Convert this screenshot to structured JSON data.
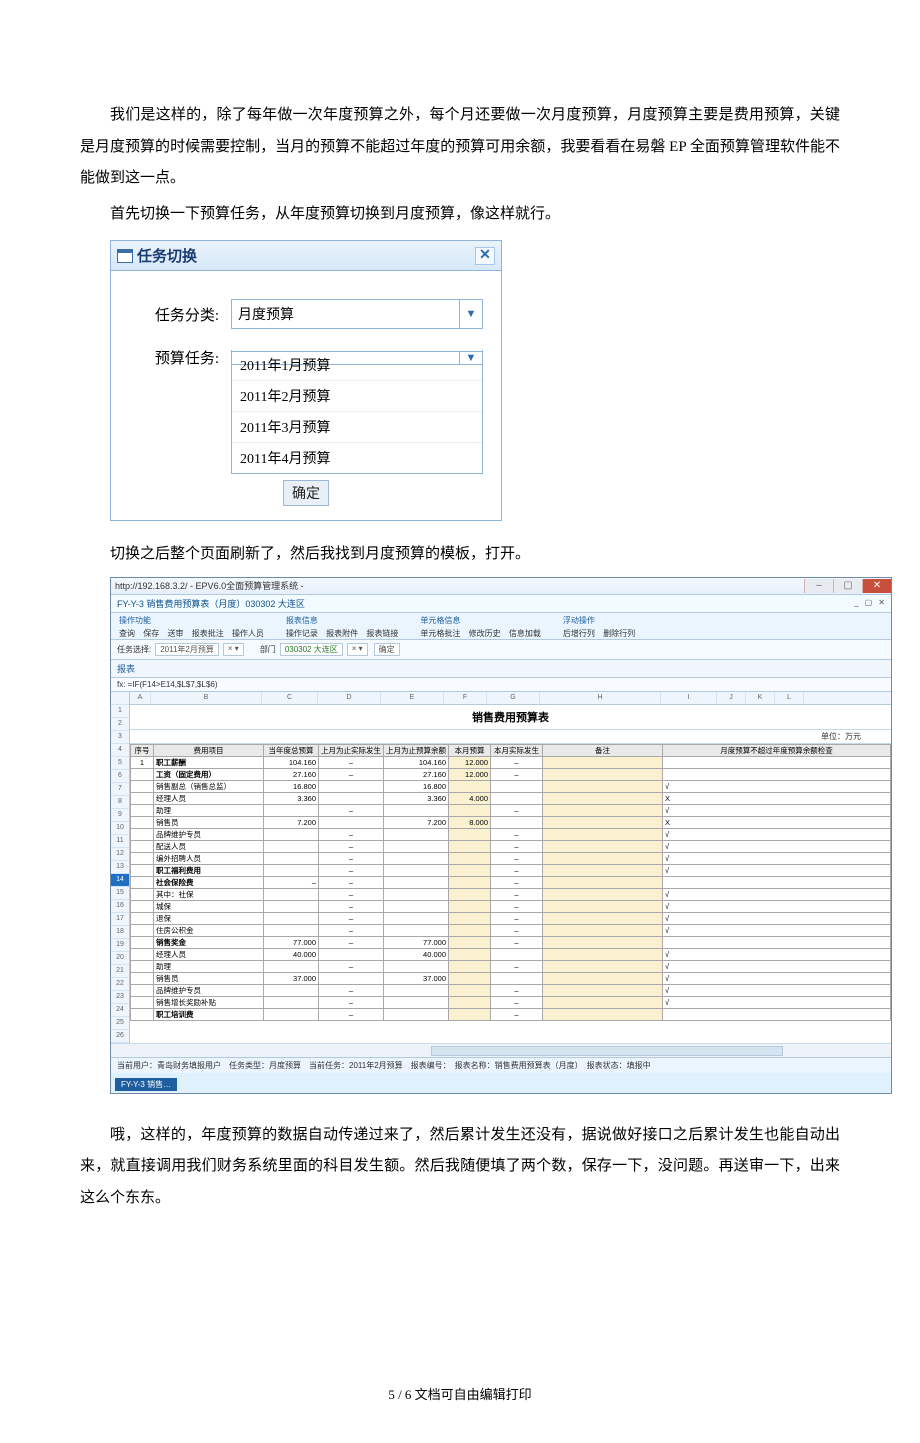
{
  "para1": "我们是这样的，除了每年做一次年度预算之外，每个月还要做一次月度预算，月度预算主要是费用预算，关键是月度预算的时候需要控制，当月的预算不能超过年度的预算可用余额，我要看看在易磐 EP 全面预算管理软件能不能做到这一点。",
  "para2": "首先切换一下预算任务，从年度预算切换到月度预算，像这样就行。",
  "para3": "切换之后整个页面刷新了，然后我找到月度预算的模板，打开。",
  "para4": "哦，这样的，年度预算的数据自动传递过来了，然后累计发生还没有，据说做好接口之后累计发生也能自动出来，就直接调用我们财务系统里面的科目发生额。然后我随便填了两个数，保存一下，没问题。再送审一下，出来这么个东东。",
  "footer": "5 / 6 文档可自由编辑打印",
  "dialog1": {
    "title": "任务切换",
    "lbl_category": "任务分类:",
    "lbl_task": "预算任务:",
    "category_value": "月度预算",
    "task_value": "",
    "options": [
      "2011年1月预算",
      "2011年2月预算",
      "2011年3月预算",
      "2011年4月预算"
    ],
    "ok": "确定"
  },
  "app": {
    "addr": "http://192.168.3.2/ - EPV6.0全面预算管理系统 -",
    "subtitle": "FY-Y-3 销售费用预算表（月度）030302 大连区",
    "groups": {
      "g1": "操作功能",
      "g1r": [
        "查询",
        "保存",
        "送审",
        "报表批注",
        "操作人员"
      ],
      "g2": "报表信息",
      "g2r": [
        "操作记录",
        "报表附件",
        "报表链接"
      ],
      "g3": "单元格信息",
      "g3r": [
        "单元格批注",
        "修改历史",
        "信息加载"
      ],
      "g4": "浮动操作",
      "g4r": [
        "后增行列",
        "删除行列"
      ]
    },
    "taskline": {
      "lbl1": "任务选择:",
      "val1": "2011年2月预算",
      "lbl2": "部门",
      "val2": "030302 大连区",
      "btn": "确定"
    },
    "section": "报表",
    "fx": "fx: =IF(F14>E14,$L$7,$L$6)",
    "cols": [
      "A",
      "B",
      "C",
      "D",
      "E",
      "F",
      "G",
      "H",
      "I",
      "J",
      "K",
      "L"
    ],
    "title": "销售费用预算表",
    "unit": "单位：万元",
    "head": [
      "序号",
      "费用项目",
      "当年度总预算",
      "上月为止实际发生",
      "上月为止预算余额",
      "本月预算",
      "本月实际发生",
      "备注",
      "月度预算不超过年度预算余额检查"
    ],
    "rows": [
      {
        "n": "1",
        "name": "职工薪酬",
        "a": "104.160",
        "c": "104.160",
        "d": "12.000",
        "dash": true,
        "bold": true
      },
      {
        "n": "",
        "name": "工资（固定费用）",
        "a": "27.160",
        "c": "27.160",
        "d": "12.000",
        "dash": true,
        "bold": true
      },
      {
        "n": "",
        "name": "销售副总（销售总监）",
        "a": "16.800",
        "c": "16.800",
        "chk": "√"
      },
      {
        "n": "",
        "name": "经理人员",
        "a": "3.360",
        "c": "3.360",
        "d": "4.000",
        "chk": "X"
      },
      {
        "n": "",
        "name": "助理",
        "dash": true,
        "chk": "√"
      },
      {
        "n": "",
        "name": "销售员",
        "a": "7.200",
        "c": "7.200",
        "d": "8.000",
        "chk": "X"
      },
      {
        "n": "",
        "name": "品牌维护专员",
        "dash": true,
        "chk": "√"
      },
      {
        "n": "",
        "name": "配送人员",
        "dash": true,
        "chk": "√"
      },
      {
        "n": "",
        "name": "编外招聘人员",
        "dash": true,
        "chk": "√"
      },
      {
        "n": "",
        "name": "职工福利费用",
        "dash": true,
        "bold": true,
        "chk": "√"
      },
      {
        "n": "",
        "name": "社会保险费",
        "dash": true,
        "dashA": true,
        "bold": true
      },
      {
        "n": "",
        "name": "其中：社保",
        "dash": true,
        "chk": "√"
      },
      {
        "n": "",
        "name": "    城保",
        "dash": true,
        "chk": "√"
      },
      {
        "n": "",
        "name": "    退保",
        "dash": true,
        "chk": "√"
      },
      {
        "n": "",
        "name": "住房公积金",
        "dash": true,
        "chk": "√"
      },
      {
        "n": "",
        "name": "销售奖金",
        "a": "77.000",
        "c": "77.000",
        "dash": true,
        "bold": true
      },
      {
        "n": "",
        "name": "经理人员",
        "a": "40.000",
        "c": "40.000",
        "chk": "√"
      },
      {
        "n": "",
        "name": "助理",
        "dash": true,
        "chk": "√"
      },
      {
        "n": "",
        "name": "销售员",
        "a": "37.000",
        "c": "37.000",
        "chk": "√"
      },
      {
        "n": "",
        "name": "品牌维护专员",
        "dash": true,
        "chk": "√"
      },
      {
        "n": "",
        "name": "销售增长奖励补贴",
        "dash": true,
        "chk": "√"
      },
      {
        "n": "",
        "name": "职工培训费",
        "dash": true,
        "bold": true
      }
    ],
    "status": "当前用户：青岛财务填报用户　任务类型：月度预算　当前任务：2011年2月预算　报表编号：　报表名称：销售费用预算表（月度）　报表状态：填报中",
    "tab": "FY-Y-3 销售…"
  }
}
